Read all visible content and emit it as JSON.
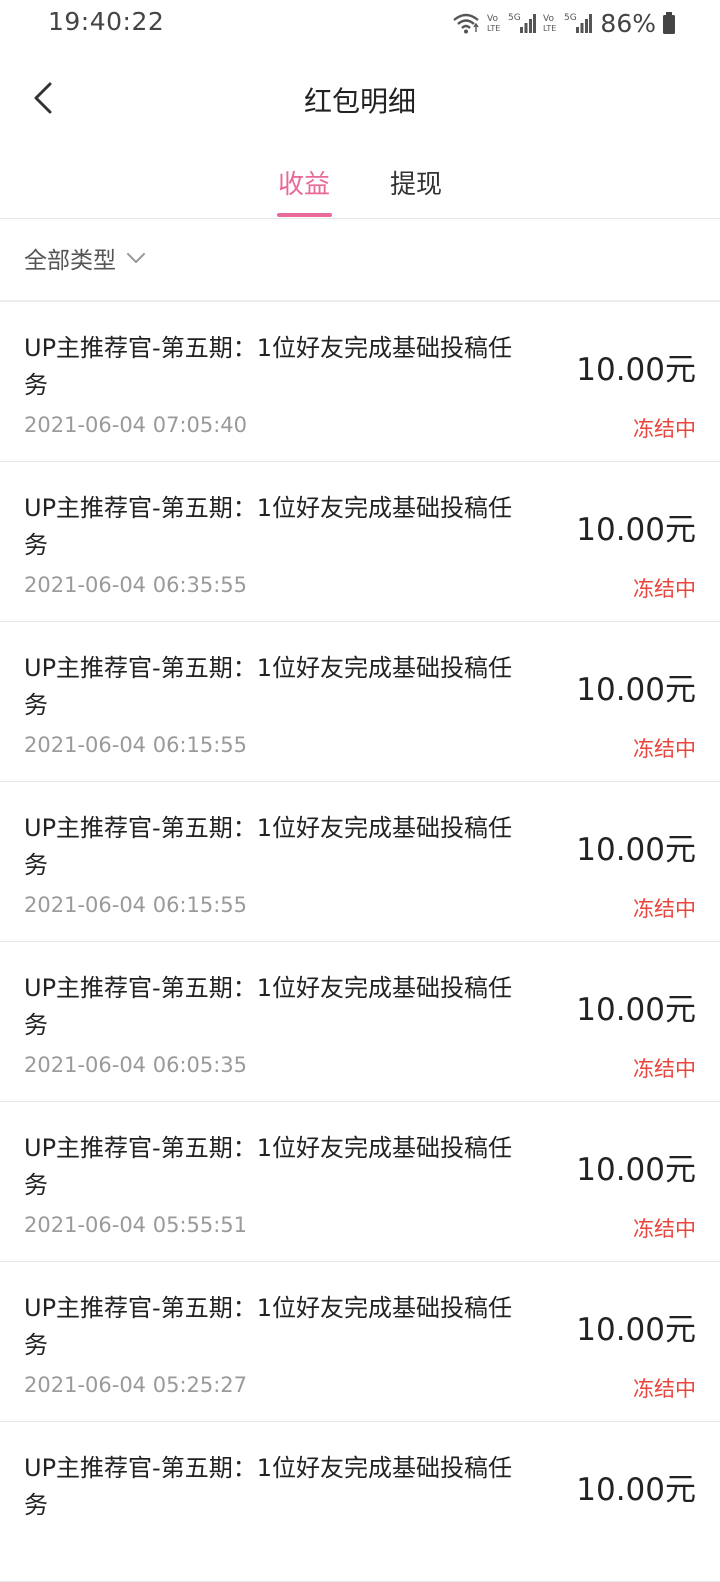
{
  "status_bar": {
    "time": "19:40:22",
    "battery": "86%",
    "icons": [
      "wifi-icon",
      "volte-icon",
      "signal-5g-icon",
      "volte-icon",
      "signal-5g-icon",
      "battery-icon"
    ]
  },
  "header": {
    "back_icon": "back-arrow-icon",
    "title": "红包明细"
  },
  "tabs": [
    {
      "label": "收益",
      "active": true
    },
    {
      "label": "提现",
      "active": false
    }
  ],
  "filter": {
    "label": "全部类型",
    "icon": "chevron-down-icon"
  },
  "colors": {
    "accent": "#e8699a",
    "status_frozen": "#e8453c",
    "muted_text": "#9a9a9a"
  },
  "items": [
    {
      "title": "UP主推荐官-第五期：1位好友完成基础投稿任务",
      "time": "2021-06-04 07:05:40",
      "amount": "10.00元",
      "status": "冻结中"
    },
    {
      "title": "UP主推荐官-第五期：1位好友完成基础投稿任务",
      "time": "2021-06-04 06:35:55",
      "amount": "10.00元",
      "status": "冻结中"
    },
    {
      "title": "UP主推荐官-第五期：1位好友完成基础投稿任务",
      "time": "2021-06-04 06:15:55",
      "amount": "10.00元",
      "status": "冻结中"
    },
    {
      "title": "UP主推荐官-第五期：1位好友完成基础投稿任务",
      "time": "2021-06-04 06:15:55",
      "amount": "10.00元",
      "status": "冻结中"
    },
    {
      "title": "UP主推荐官-第五期：1位好友完成基础投稿任务",
      "time": "2021-06-04 06:05:35",
      "amount": "10.00元",
      "status": "冻结中"
    },
    {
      "title": "UP主推荐官-第五期：1位好友完成基础投稿任务",
      "time": "2021-06-04 05:55:51",
      "amount": "10.00元",
      "status": "冻结中"
    },
    {
      "title": "UP主推荐官-第五期：1位好友完成基础投稿任务",
      "time": "2021-06-04 05:25:27",
      "amount": "10.00元",
      "status": "冻结中"
    },
    {
      "title": "UP主推荐官-第五期：1位好友完成基础投稿任务",
      "time": "",
      "amount": "10.00元",
      "status": ""
    }
  ]
}
